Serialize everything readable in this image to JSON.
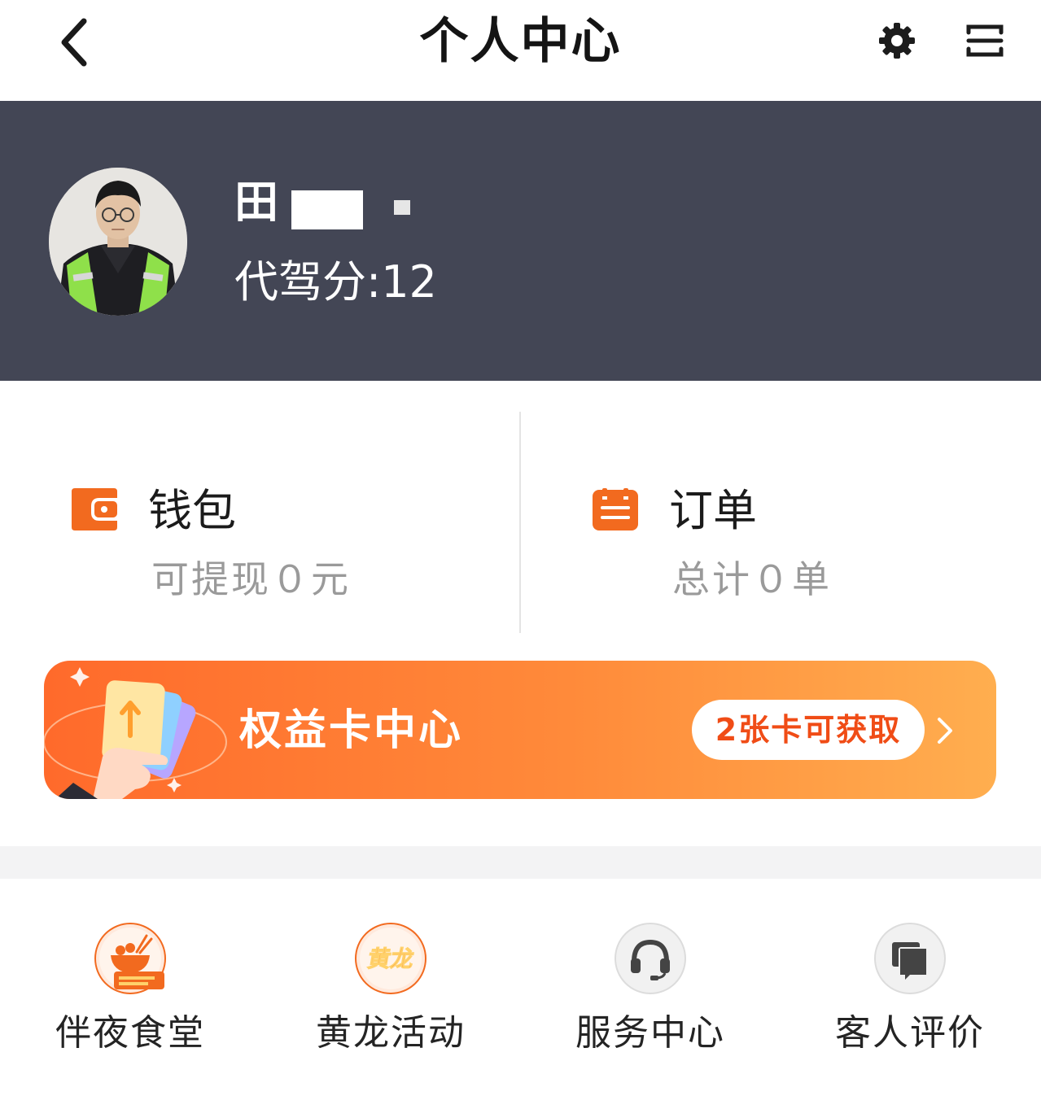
{
  "nav": {
    "title": "个人中心",
    "back_icon": "chevron-left-icon",
    "settings_icon": "gear-icon",
    "menu_icon": "scan-icon"
  },
  "profile": {
    "name": "田",
    "score_text": "代驾分:12",
    "avatar": "avatar-photo",
    "background_color": "#434655"
  },
  "stats": {
    "wallet": {
      "title": "钱包",
      "subtitle": "可提现０元",
      "icon": "wallet-icon"
    },
    "orders": {
      "title": "订单",
      "subtitle": "总计０单",
      "icon": "order-list-icon"
    }
  },
  "banner": {
    "title": "权益卡中心",
    "badge": "2张卡可获取",
    "arrow_icon": "chevron-right-icon",
    "colors": [
      "#ff6a2b",
      "#ffae4f"
    ]
  },
  "shortcuts": [
    {
      "label": "伴夜食堂",
      "icon": "night-canteen-icon"
    },
    {
      "label": "黄龙活动",
      "icon": "huanglong-logo-icon",
      "icon_text": "黄龙"
    },
    {
      "label": "服务中心",
      "icon": "headset-icon"
    },
    {
      "label": "客人评价",
      "icon": "review-cards-icon"
    }
  ],
  "theme": {
    "accent": "#f26a1f",
    "text_muted": "#9a9a9a"
  }
}
